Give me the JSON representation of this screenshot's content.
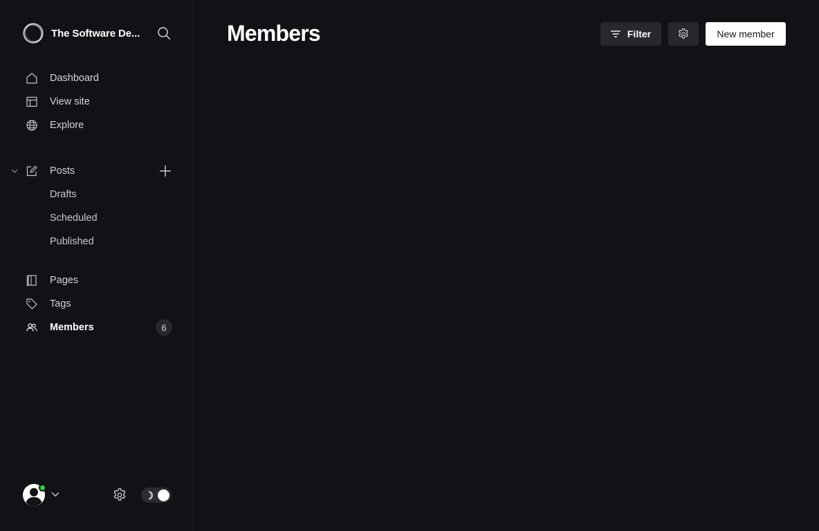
{
  "brand": {
    "name": "The Software De..."
  },
  "sidebar": {
    "primary": [
      {
        "label": "Dashboard",
        "icon": "home-icon"
      },
      {
        "label": "View site",
        "icon": "layout-icon"
      },
      {
        "label": "Explore",
        "icon": "globe-icon"
      }
    ],
    "posts": {
      "label": "Posts",
      "icon": "pencil-icon",
      "subitems": [
        "Drafts",
        "Scheduled",
        "Published"
      ]
    },
    "secondary": [
      {
        "label": "Pages",
        "icon": "page-icon"
      },
      {
        "label": "Tags",
        "icon": "tag-icon"
      },
      {
        "label": "Members",
        "icon": "members-icon",
        "active": true,
        "count": "6"
      }
    ]
  },
  "header": {
    "title": "Members",
    "filter_label": "Filter",
    "new_member_label": "New member"
  },
  "colors": {
    "background": "#111216",
    "button_bg": "#26282d",
    "online": "#30cf43"
  }
}
